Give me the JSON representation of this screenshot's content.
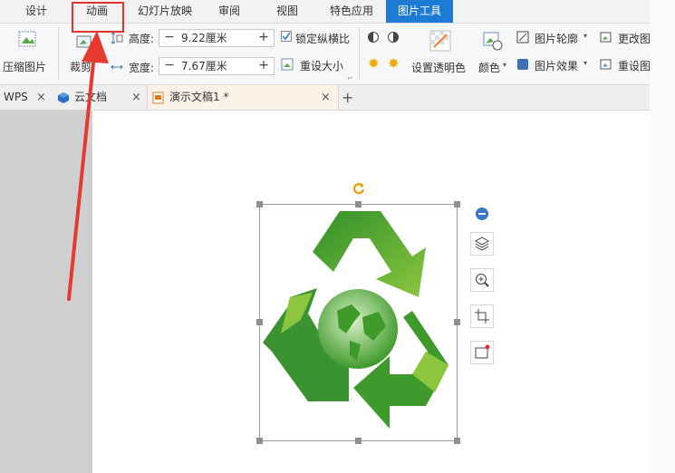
{
  "menu_tabs": {
    "design": "设计",
    "animation": "动画",
    "slideshow": "幻灯片放映",
    "review": "审阅",
    "view": "视图",
    "special": "特色应用",
    "picture_tools": "图片工具"
  },
  "ribbon": {
    "compress": "压缩图片",
    "crop": "裁剪",
    "height_label": "高度:",
    "height_value": "9.22厘米",
    "width_label": "宽度:",
    "width_value": "7.67厘米",
    "lock_ratio": "锁定纵横比",
    "reset_size": "重设大小",
    "set_transparent": "设置透明色",
    "color": "颜色",
    "outline": "图片轮廓",
    "effects": "图片效果",
    "change_pic": "更改图",
    "reset_pic": "重设图",
    "lock_checked": true
  },
  "doc_tabs": {
    "wps": "WPS",
    "cloud": "云文档",
    "doc": "演示文稿1 *"
  },
  "colors": {
    "accent": "#1e7bd3",
    "highlight_box": "#e0312b",
    "arrow": "#e63a30",
    "recycle_dark": "#3f9a2c",
    "recycle_light": "#8cc63f"
  }
}
